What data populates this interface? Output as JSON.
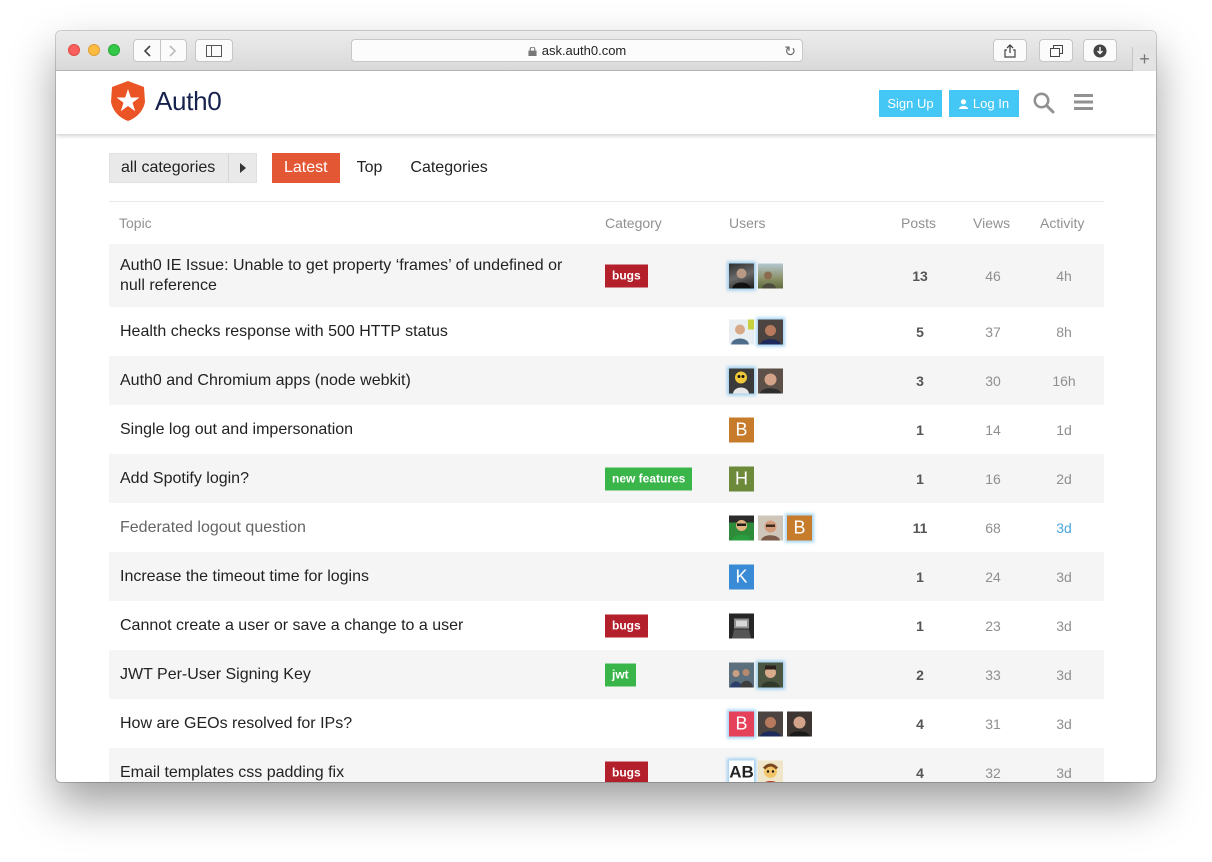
{
  "browser": {
    "url": "ask.auth0.com"
  },
  "site": {
    "logo_text": "Auth0",
    "signup_label": "Sign Up",
    "login_label": "Log In",
    "brand_color": "#eb5424",
    "button_color": "#44c7f4"
  },
  "nav": {
    "category_filter": "all categories",
    "tabs": [
      "Latest",
      "Top",
      "Categories"
    ],
    "active_tab": "Latest"
  },
  "table": {
    "headers": {
      "topic": "Topic",
      "category": "Category",
      "users": "Users",
      "posts": "Posts",
      "views": "Views",
      "activity": "Activity"
    },
    "rows": [
      {
        "title": "Auth0 IE Issue: Unable to get property ‘frames’ of undefined or null reference",
        "category": "bugs",
        "users": [
          "photo-dark",
          "photo-outdoor"
        ],
        "posts": "13",
        "views": "46",
        "activity": "4h"
      },
      {
        "title": "Health checks response with 500 HTTP status",
        "category": "",
        "users": [
          "photo-man",
          "photo-brown"
        ],
        "posts": "5",
        "views": "37",
        "activity": "8h"
      },
      {
        "title": "Auth0 and Chromium apps (node webkit)",
        "category": "",
        "users": [
          "photo-cartoon",
          "photo-bald"
        ],
        "posts": "3",
        "views": "30",
        "activity": "16h"
      },
      {
        "title": "Single log out and impersonation",
        "category": "",
        "users": [
          "B"
        ],
        "posts": "1",
        "views": "14",
        "activity": "1d"
      },
      {
        "title": "Add Spotify login?",
        "category": "new features",
        "users": [
          "H"
        ],
        "posts": "1",
        "views": "16",
        "activity": "2d"
      },
      {
        "title": "Federated logout question",
        "category": "",
        "users": [
          "photo-green",
          "photo-glasses",
          "B"
        ],
        "posts": "11",
        "views": "68",
        "activity": "3d"
      },
      {
        "title": "Increase the timeout time for logins",
        "category": "",
        "users": [
          "K"
        ],
        "posts": "1",
        "views": "24",
        "activity": "3d"
      },
      {
        "title": "Cannot create a user or save a change to a user",
        "category": "bugs",
        "users": [
          "photo-laptop"
        ],
        "posts": "1",
        "views": "23",
        "activity": "3d"
      },
      {
        "title": "JWT Per-User Signing Key",
        "category": "jwt",
        "users": [
          "photo-people",
          "photo-man2"
        ],
        "posts": "2",
        "views": "33",
        "activity": "3d"
      },
      {
        "title": "How are GEOs resolved for IPs?",
        "category": "",
        "users": [
          "B",
          "photo-brown",
          "photo-dark2"
        ],
        "posts": "4",
        "views": "31",
        "activity": "3d"
      },
      {
        "title": "Email templates css padding fix",
        "category": "bugs",
        "users": [
          "AB",
          "photo-cartoon2"
        ],
        "posts": "4",
        "views": "32",
        "activity": "3d"
      }
    ]
  },
  "colors": {
    "latest_tab": "#e45735",
    "bugs_badge": "#b3202b",
    "green_badge": "#3ab54a",
    "avatar_B_orange": "#c77c2c",
    "avatar_H": "#6c8a3a",
    "avatar_K": "#3a8bd5",
    "avatar_B_pink": "#e5415a",
    "recent_activity": "#4ba7dc"
  }
}
